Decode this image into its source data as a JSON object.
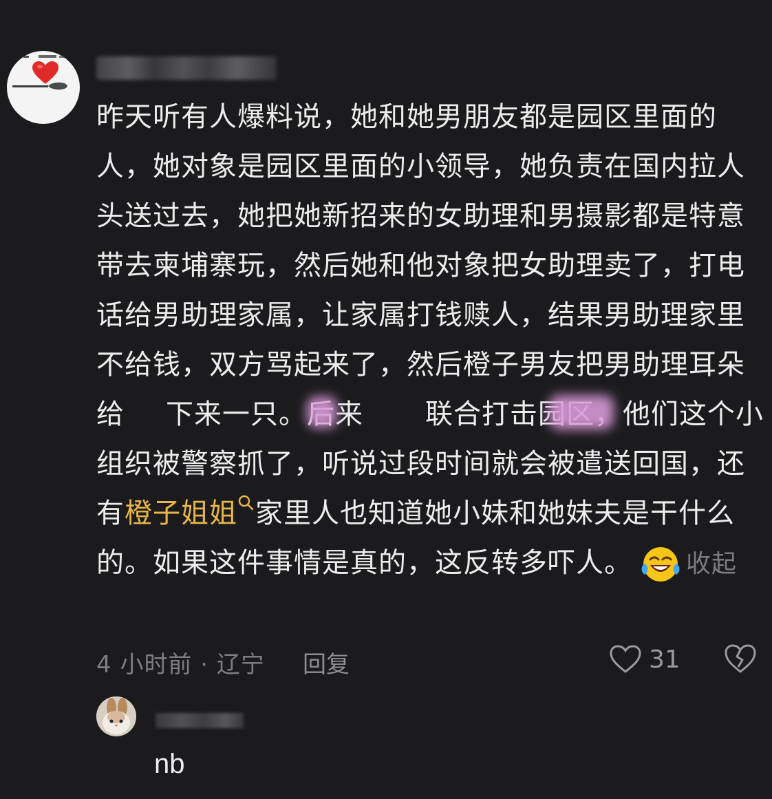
{
  "comment": {
    "body_part1": "昨天听有人爆料说，她和她男朋友都是园区里面的人，她对象是园区里面的小领导，她负责在国内拉人头送过去，她把她新招来的女助理和男摄影都是特意带去柬埔寨玩，然后她和他对象把女助理卖了，打电话给男助理家属，让家属打钱赎人，结果男助理家里不给钱，双方骂起来了，然后橙子男友把男助理耳朵给",
    "body_part2": "下来一只。后来",
    "body_part3": "联合打击园区，他们这个小组织被警察抓了，听说过段时间就会被遣送回国，还有",
    "highlight": "橙子姐姐",
    "body_part4": "家里人也知道她小妹和她妹夫是干什么的。如果这件事情是真的，这反转多吓人。",
    "collapse_label": "收起",
    "meta": "4 小时前 · 辽宁",
    "reply_label": "回复",
    "like_count": "31",
    "icons": {
      "avatar": "heart-spoon-avatar",
      "search": "search-icon",
      "emoji": "crying-laughing-emoji",
      "like": "heart-outline-icon",
      "dislike": "broken-heart-icon"
    }
  },
  "reply": {
    "text": "nb",
    "icons": {
      "avatar": "rabbit-avatar"
    }
  },
  "colors": {
    "background": "#1b1b1d",
    "text": "#ececec",
    "highlight": "#e8b548",
    "muted": "#7e7e80"
  }
}
